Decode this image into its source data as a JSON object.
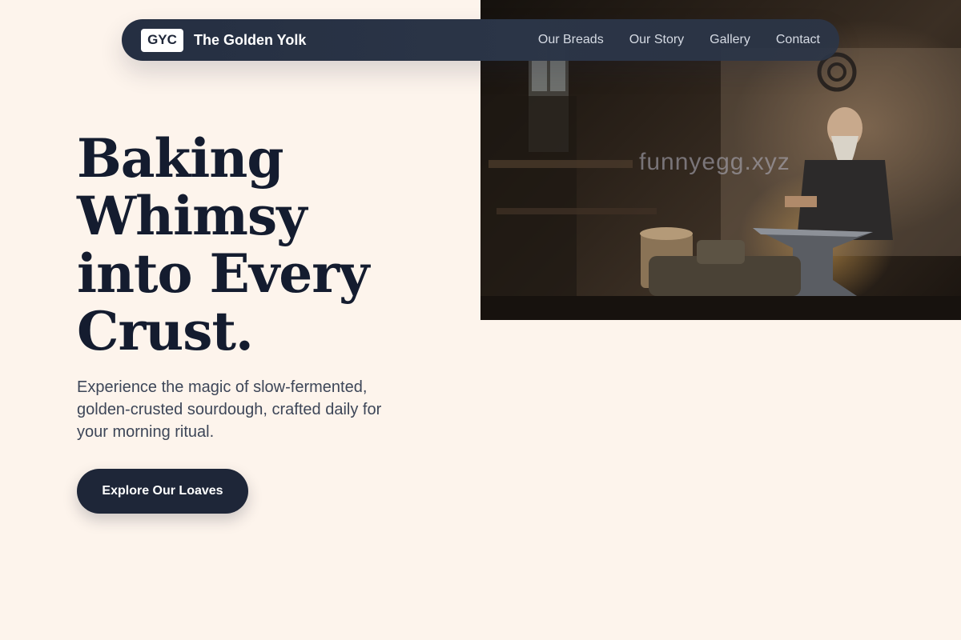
{
  "nav": {
    "logo": "GYC",
    "brand": "The Golden Yolk",
    "links": [
      "Our Breads",
      "Our Story",
      "Gallery",
      "Contact"
    ]
  },
  "hero": {
    "headline_lines": [
      "Baking",
      "Whimsy",
      "into Every",
      "Crust."
    ],
    "subtext": "Experience the magic of slow-fermented, golden-crusted sourdough, crafted daily for your morning ritual.",
    "cta_label": "Explore Our Loaves",
    "image_watermark": "funnyegg.xyz"
  },
  "colors": {
    "background": "#fdf4ec",
    "nav_bg": "#252f42",
    "ink": "#141c2f",
    "cta_bg": "#1e2638"
  }
}
